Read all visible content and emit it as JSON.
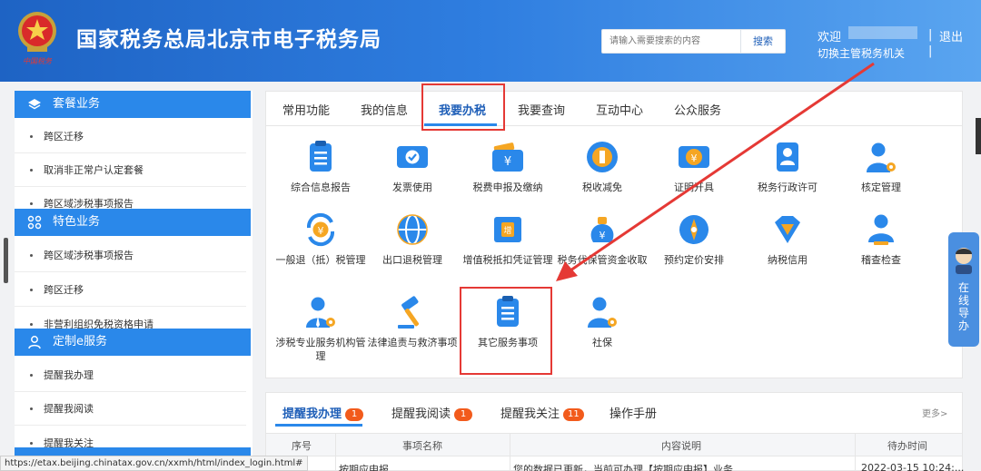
{
  "header": {
    "site_title": "国家税务总局北京市电子税务局",
    "search_placeholder": "请输入需要搜索的内容",
    "search_button": "搜索",
    "welcome": "欢迎",
    "switch_org": "切换主管税务机关",
    "separator": "|",
    "logout": "退出",
    "emblem_text": "中国税务"
  },
  "sidebar": {
    "sections": [
      {
        "title": "套餐业务",
        "icon": "layers-icon",
        "items": [
          "跨区迁移",
          "取消非正常户认定套餐",
          "跨区域涉税事项报告"
        ]
      },
      {
        "title": "特色业务",
        "icon": "grid-icon",
        "items": [
          "跨区域涉税事项报告",
          "跨区迁移",
          "非营利组织免税资格申请"
        ]
      },
      {
        "title": "定制e服务",
        "icon": "user-icon",
        "items": [
          "提醒我办理",
          "提醒我阅读",
          "提醒我关注"
        ]
      }
    ]
  },
  "main": {
    "tabs": [
      "常用功能",
      "我的信息",
      "我要办税",
      "我要查询",
      "互动中心",
      "公众服务"
    ],
    "active_tab": "我要办税",
    "services": [
      "综合信息报告",
      "发票使用",
      "税费申报及缴纳",
      "税收减免",
      "证明开具",
      "税务行政许可",
      "核定管理",
      "一般退（抵）税管理",
      "出口退税管理",
      "增值税抵扣凭证管理",
      "税务代保管资金收取",
      "预约定价安排",
      "纳税信用",
      "稽查检查",
      "涉税专业服务机构管理",
      "法律追责与救济事项",
      "其它服务事项",
      "社保"
    ]
  },
  "float_widget": {
    "label": "在线导办"
  },
  "reminders": {
    "tabs": [
      {
        "label": "提醒我办理",
        "count": "1"
      },
      {
        "label": "提醒我阅读",
        "count": "1"
      },
      {
        "label": "提醒我关注",
        "count": "11"
      },
      {
        "label": "操作手册",
        "count": ""
      }
    ],
    "more": "更多>",
    "columns": [
      "序号",
      "事项名称",
      "内容说明",
      "待办时间"
    ],
    "rows": [
      {
        "index": "1",
        "name": "按期应申报",
        "desc": "您的数据已更新，当前可办理【按期应申报】业务",
        "time": "2022-03-15 10:24:..."
      }
    ]
  },
  "status_bar": {
    "url": "https://etax.beijing.chinatax.gov.cn/xxmh/html/index_login.html#"
  },
  "colors": {
    "accent": "#2a88ea",
    "header_start": "#1e63c4",
    "highlight": "#e53935",
    "badge": "#f25b1c"
  }
}
